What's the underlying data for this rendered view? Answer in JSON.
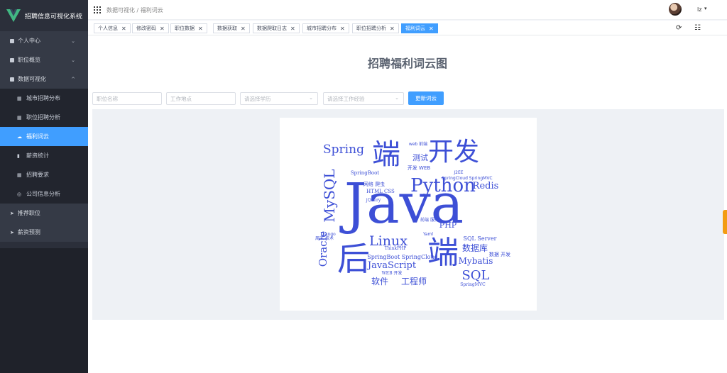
{
  "app": {
    "title": "招聘信息可视化系统"
  },
  "sidebar": {
    "items": [
      {
        "label": "个人中心",
        "type": "parent",
        "icon": "square-icon",
        "chevron": "⌄"
      },
      {
        "label": "职位概览",
        "type": "parent",
        "icon": "square-icon",
        "chevron": "⌄"
      },
      {
        "label": "数据可视化",
        "type": "parent-open",
        "icon": "square-icon",
        "chevron": "^"
      },
      {
        "label": "城市招聘分布",
        "type": "sub",
        "icon": "grid-icon"
      },
      {
        "label": "职位招聘分析",
        "type": "sub",
        "icon": "grid-icon"
      },
      {
        "label": "福利词云",
        "type": "sub-active",
        "icon": "cloud-icon"
      },
      {
        "label": "薪资统计",
        "type": "sub",
        "icon": "chart-icon"
      },
      {
        "label": "招聘要求",
        "type": "sub",
        "icon": "grid-icon"
      },
      {
        "label": "公司信息分析",
        "type": "sub",
        "icon": "info-icon"
      },
      {
        "label": "推荐职位",
        "type": "bottom",
        "icon": "send-icon"
      },
      {
        "label": "薪资预测",
        "type": "bottom",
        "icon": "send-icon"
      }
    ]
  },
  "navbar": {
    "breadcrumb": "数据可视化 / 福利词云",
    "user": "lz",
    "caret": "▾"
  },
  "tags": [
    {
      "label": "个人信息",
      "active": false
    },
    {
      "label": "修改密码",
      "active": false
    },
    {
      "label": "职位数据",
      "active": false
    },
    {
      "label": "数据获取",
      "active": false
    },
    {
      "label": "数据爬取日志",
      "active": false
    },
    {
      "label": "城市招聘分布",
      "active": false
    },
    {
      "label": "职位招聘分析",
      "active": false
    },
    {
      "label": "福利词云",
      "active": true
    }
  ],
  "tag_close": "✕",
  "toolbar": {
    "refresh": "⟳",
    "tune": "☷"
  },
  "main": {
    "title": "招聘福利词云图",
    "filters": {
      "position_placeholder": "职位名称",
      "location_placeholder": "工作地点",
      "education_placeholder": "请选择学历",
      "experience_placeholder": "请选择工作经验",
      "caret": "⌄"
    },
    "update_button": "更新词云"
  },
  "wordcloud": {
    "color": "#3d4fd6",
    "words": [
      {
        "text": "Java",
        "weight": 100
      },
      {
        "text": "端",
        "weight": 62
      },
      {
        "text": "后",
        "weight": 58
      },
      {
        "text": "开发",
        "weight": 50
      },
      {
        "text": "端",
        "weight": 44
      },
      {
        "text": "Python",
        "weight": 40
      },
      {
        "text": "MySQL",
        "weight": 34
      },
      {
        "text": "Spring",
        "weight": 28
      },
      {
        "text": "Linux",
        "weight": 30
      },
      {
        "text": "SQL",
        "weight": 28
      },
      {
        "text": "Oracle",
        "weight": 24
      },
      {
        "text": "JavaScript",
        "weight": 22
      },
      {
        "text": "Redis",
        "weight": 20
      },
      {
        "text": "测试",
        "weight": 18
      },
      {
        "text": "数据库",
        "weight": 18
      },
      {
        "text": "Mybatis",
        "weight": 18
      },
      {
        "text": "PHP",
        "weight": 16
      },
      {
        "text": "软件",
        "weight": 18
      },
      {
        "text": "工程师",
        "weight": 18
      },
      {
        "text": "SQL Server",
        "weight": 12
      },
      {
        "text": "SpringBoot SpringCloud",
        "weight": 11
      },
      {
        "text": "SpringBoot",
        "weight": 10
      },
      {
        "text": "HTML CSS",
        "weight": 10
      },
      {
        "text": "jQuery",
        "weight": 9
      },
      {
        "text": "ThinkPHP",
        "weight": 9
      },
      {
        "text": "SpringMVC",
        "weight": 9
      },
      {
        "text": "WEB 开发",
        "weight": 9
      },
      {
        "text": "web 前端",
        "weight": 9
      },
      {
        "text": "数据 开发",
        "weight": 10
      },
      {
        "text": "开发 WEB",
        "weight": 10
      },
      {
        "text": "J2EE",
        "weight": 9
      },
      {
        "text": "SpringCloud SpringMVC",
        "weight": 8
      },
      {
        "text": "网络 爬虫",
        "weight": 10
      },
      {
        "text": "Django",
        "weight": 8
      },
      {
        "text": "周末 技术",
        "weight": 8
      },
      {
        "text": "Yaml",
        "weight": 7
      },
      {
        "text": "前端 服务",
        "weight": 9
      }
    ]
  }
}
